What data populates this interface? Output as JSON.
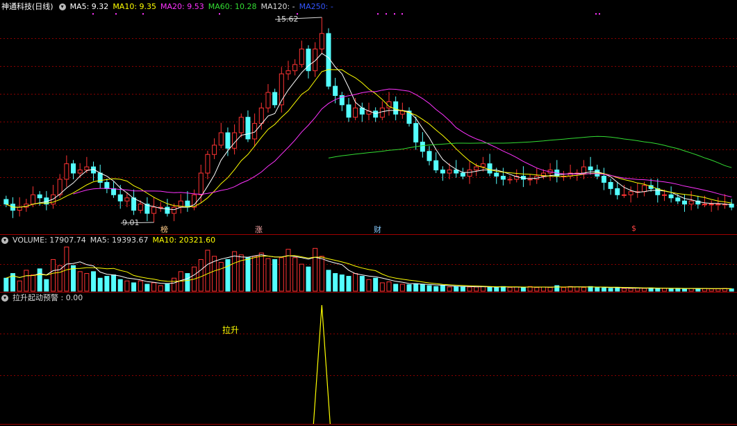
{
  "main_panel": {
    "stock_title": "神通科技(日线)",
    "ma": [
      {
        "label": "MA5: 9.32",
        "color": "#ffffff"
      },
      {
        "label": "MA10: 9.35",
        "color": "#ffff00"
      },
      {
        "label": "MA20: 9.53",
        "color": "#ff33ff"
      },
      {
        "label": "MA60: 10.28",
        "color": "#33dd33"
      },
      {
        "label": "MA120: -",
        "color": "#dddddd"
      },
      {
        "label": "MA250: -",
        "color": "#3355ff"
      }
    ],
    "high_label": "15.62",
    "low_label": "9.01",
    "markers": [
      {
        "text": "榜",
        "color": "#ffcc88"
      },
      {
        "text": "涨",
        "color": "#ffaaaa"
      },
      {
        "text": "财",
        "color": "#88ccff"
      },
      {
        "text": "$",
        "color": "#ff4444"
      }
    ]
  },
  "volume_panel": {
    "title": "VOLUME: 17907.74",
    "ma5": "MA5: 19393.67",
    "ma10": "MA10: 20321.60"
  },
  "indicator_panel": {
    "title": "拉升起动预警 : 0.00",
    "signal_label": "拉升"
  },
  "colors": {
    "up": "#ff3333",
    "down": "#54ffff",
    "ma5": "#ffffff",
    "ma10": "#ffff00",
    "ma20": "#ff33ff",
    "ma60": "#33dd33",
    "grid": "#8b0000"
  },
  "chart_data": {
    "type": "candlestick",
    "price_range": [
      9.01,
      15.62
    ],
    "closes": [
      9.6,
      9.4,
      9.5,
      9.6,
      9.9,
      9.8,
      9.6,
      9.9,
      10.4,
      10.9,
      10.6,
      10.7,
      10.8,
      10.6,
      10.3,
      10.1,
      9.9,
      9.7,
      9.8,
      9.4,
      9.6,
      9.3,
      9.5,
      9.5,
      9.3,
      9.5,
      9.7,
      9.5,
      9.9,
      10.6,
      11.2,
      11.5,
      11.9,
      11.4,
      11.9,
      12.4,
      11.7,
      12.2,
      12.7,
      13.2,
      12.8,
      13.8,
      13.9,
      14.1,
      14.6,
      13.9,
      14.6,
      15.1,
      13.4,
      13.1,
      12.8,
      12.4,
      12.7,
      12.5,
      12.6,
      12.4,
      12.7,
      12.9,
      12.5,
      12.6,
      12.2,
      11.6,
      11.3,
      11.0,
      10.7,
      10.6,
      10.7,
      10.6,
      10.5,
      10.7,
      10.8,
      10.9,
      10.6,
      10.5,
      10.4,
      10.4,
      10.5,
      10.4,
      10.4,
      10.5,
      10.6,
      10.7,
      10.5,
      10.5,
      10.6,
      10.6,
      10.8,
      10.7,
      10.5,
      10.3,
      10.1,
      9.9,
      9.9,
      10.0,
      10.0,
      10.2,
      10.1,
      9.9,
      9.9,
      9.8,
      9.7,
      9.6,
      9.7,
      9.6,
      9.6,
      9.6,
      9.6,
      9.6,
      9.5
    ],
    "volume_ratio": [
      0.28,
      0.38,
      0.22,
      0.45,
      0.35,
      0.48,
      0.25,
      0.68,
      0.55,
      0.95,
      0.55,
      0.42,
      0.38,
      0.42,
      0.28,
      0.32,
      0.35,
      0.25,
      0.22,
      0.18,
      0.22,
      0.15,
      0.18,
      0.12,
      0.15,
      0.28,
      0.42,
      0.38,
      0.52,
      0.68,
      0.88,
      0.75,
      0.62,
      0.68,
      0.85,
      0.78,
      0.72,
      0.75,
      0.82,
      0.7,
      0.68,
      0.72,
      0.9,
      0.72,
      0.58,
      0.52,
      0.92,
      0.75,
      0.45,
      0.38,
      0.35,
      0.32,
      0.38,
      0.32,
      0.25,
      0.28,
      0.18,
      0.2,
      0.15,
      0.15,
      0.14,
      0.16,
      0.15,
      0.12,
      0.1,
      0.12,
      0.09,
      0.1,
      0.1,
      0.09,
      0.09,
      0.1,
      0.09,
      0.08,
      0.1,
      0.08,
      0.09,
      0.08,
      0.1,
      0.08,
      0.09,
      0.08,
      0.12,
      0.08,
      0.1,
      0.09,
      0.08,
      0.1,
      0.08,
      0.07,
      0.06,
      0.08,
      0.06,
      0.06,
      0.07,
      0.06,
      0.07,
      0.06,
      0.06,
      0.05,
      0.06,
      0.05,
      0.06,
      0.05,
      0.06,
      0.05,
      0.05,
      0.06,
      0.05
    ],
    "signal_index": 47
  }
}
